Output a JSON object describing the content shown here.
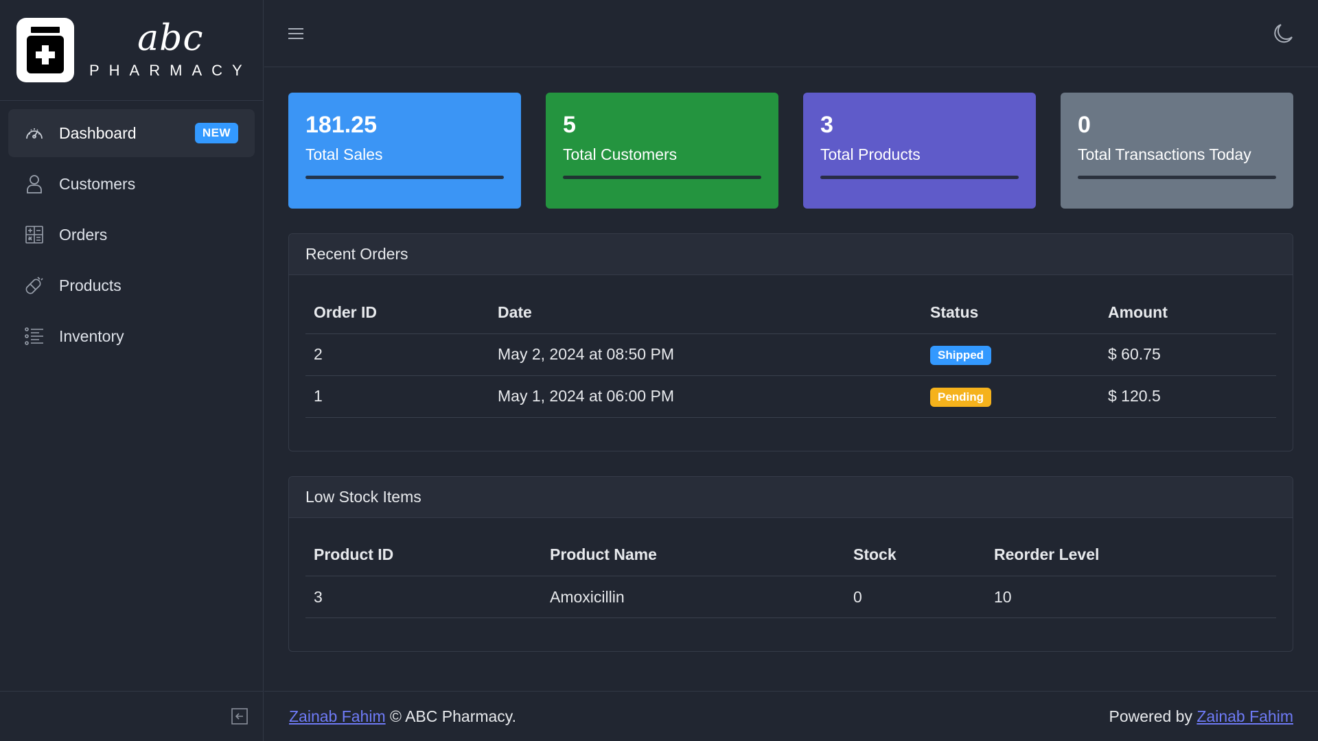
{
  "brand": {
    "script": "abc",
    "word": "PHARMACY"
  },
  "sidebar": {
    "items": [
      {
        "label": "Dashboard",
        "icon": "speedometer-icon",
        "badge": "NEW",
        "active": true
      },
      {
        "label": "Customers",
        "icon": "user-icon"
      },
      {
        "label": "Orders",
        "icon": "calculator-icon"
      },
      {
        "label": "Products",
        "icon": "pill-icon"
      },
      {
        "label": "Inventory",
        "icon": "list-icon"
      }
    ],
    "collapse_icon": "collapse-icon"
  },
  "header": {
    "menu_icon": "hamburger-icon",
    "theme_icon": "moon-icon"
  },
  "stats": [
    {
      "value": "181.25",
      "label": "Total Sales",
      "color": "#3b95f5"
    },
    {
      "value": "5",
      "label": "Total Customers",
      "color": "#24943f"
    },
    {
      "value": "3",
      "label": "Total Products",
      "color": "#5f5bc9"
    },
    {
      "value": "0",
      "label": "Total Transactions Today",
      "color": "#6b7785"
    }
  ],
  "recent_orders": {
    "title": "Recent Orders",
    "columns": [
      "Order ID",
      "Date",
      "Status",
      "Amount"
    ],
    "rows": [
      {
        "id": "2",
        "date": "May 2, 2024 at 08:50 PM",
        "status": "Shipped",
        "status_color": "#3399ff",
        "amount": "$ 60.75"
      },
      {
        "id": "1",
        "date": "May 1, 2024 at 06:00 PM",
        "status": "Pending",
        "status_color": "#f5b21c",
        "amount": "$ 120.5"
      }
    ]
  },
  "low_stock": {
    "title": "Low Stock Items",
    "columns": [
      "Product ID",
      "Product Name",
      "Stock",
      "Reorder Level"
    ],
    "rows": [
      {
        "id": "3",
        "name": "Amoxicillin",
        "stock": "0",
        "reorder": "10"
      }
    ]
  },
  "footer": {
    "author": "Zainab Fahim",
    "copyright": "© ABC Pharmacy.",
    "powered_by": "Powered by",
    "powered_author": "Zainab Fahim"
  }
}
